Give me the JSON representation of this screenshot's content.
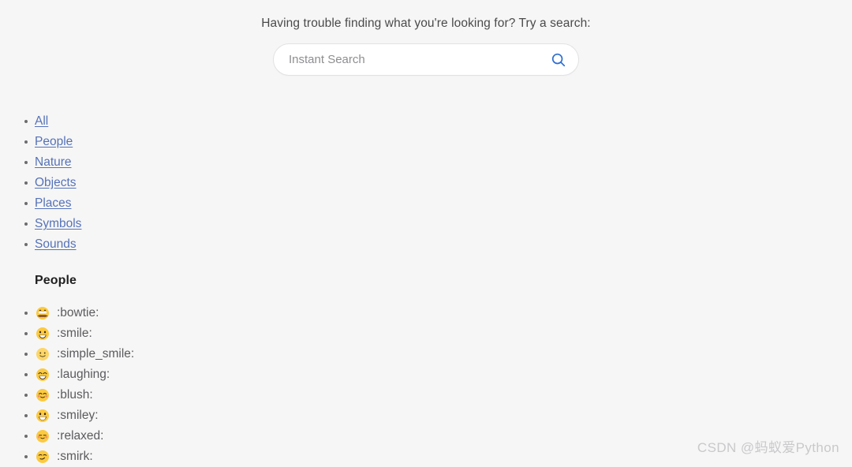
{
  "search": {
    "prompt": "Having trouble finding what you're looking for? Try a search:",
    "placeholder": "Instant Search",
    "value": "",
    "icon": "search-icon",
    "icon_color": "#2f6fd0"
  },
  "categories": {
    "link_color": "#5572b8",
    "items": [
      {
        "label": "All"
      },
      {
        "label": "People"
      },
      {
        "label": "Nature"
      },
      {
        "label": "Objects"
      },
      {
        "label": "Places"
      },
      {
        "label": "Symbols"
      },
      {
        "label": "Sounds"
      }
    ]
  },
  "section": {
    "heading": "People",
    "emojis": [
      {
        "glyph": "bowtie-face-emoji",
        "code": ":bowtie:"
      },
      {
        "glyph": "smile-emoji",
        "code": ":smile:"
      },
      {
        "glyph": "simple-smile-emoji",
        "code": ":simple_smile:"
      },
      {
        "glyph": "laughing-emoji",
        "code": ":laughing:"
      },
      {
        "glyph": "blush-emoji",
        "code": ":blush:"
      },
      {
        "glyph": "smiley-emoji",
        "code": ":smiley:"
      },
      {
        "glyph": "relaxed-emoji",
        "code": ":relaxed:"
      },
      {
        "glyph": "smirk-emoji",
        "code": ":smirk:"
      }
    ]
  },
  "watermark": {
    "text": "CSDN @蚂蚁爱Python"
  },
  "colors": {
    "page_background": "#f6f6f6",
    "input_background": "#ffffff",
    "input_border": "#e2e2e4",
    "text": "#4a4a4a",
    "muted_text": "#5b5b5f"
  }
}
